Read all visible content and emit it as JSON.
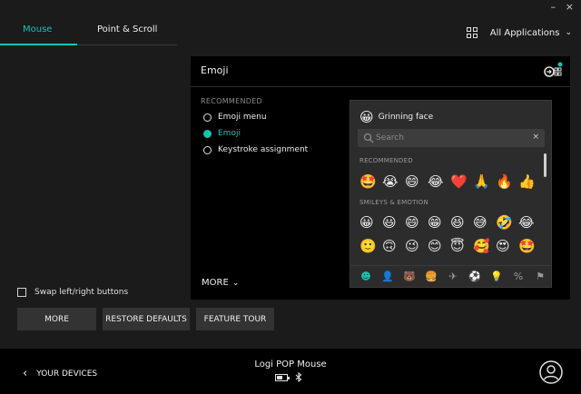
{
  "window": {
    "minimize": "–",
    "close": "×"
  },
  "tabs": [
    {
      "label": "Mouse",
      "active": true
    },
    {
      "label": "Point & Scroll",
      "active": false
    }
  ],
  "apps": {
    "label": "All Applications",
    "icon": "grid-icon",
    "chevron": "⌄"
  },
  "panel": {
    "title": "Emoji",
    "icon": "action-assign-icon",
    "recommended_label": "RECOMMENDED",
    "options": [
      {
        "label": "Emoji menu",
        "selected": false
      },
      {
        "label": "Emoji",
        "selected": true
      },
      {
        "label": "Keystroke assignment",
        "selected": false
      }
    ],
    "more_label": "MORE",
    "more_chevron": "⌄"
  },
  "picker": {
    "preview_emoji": "😀",
    "preview_name": "Grinning face",
    "search_placeholder": "Search",
    "search_clear": "×",
    "sections": [
      {
        "label": "RECOMMENDED",
        "rows": [
          [
            "🤩",
            "😭",
            "😄",
            "😂",
            "❤️",
            "🙏",
            "🔥",
            "👍"
          ]
        ]
      },
      {
        "label": "SMILEYS & EMOTION",
        "rows": [
          [
            "😀",
            "😃",
            "😄",
            "😁",
            "😆",
            "😅",
            "🤣",
            "😂"
          ],
          [
            "🙂",
            "🙃",
            "😉",
            "😊",
            "😇",
            "🥰",
            "😍",
            "🤩"
          ]
        ]
      }
    ],
    "categories": [
      "☻",
      "👤",
      "🐻",
      "🍔",
      "✈",
      "⚽",
      "💡",
      "%",
      "⚑"
    ],
    "accent": "#14c3b5"
  },
  "swap": {
    "label": "Swap left/right buttons",
    "checked": false
  },
  "buttons": {
    "more": "MORE",
    "restore": "RESTORE DEFAULTS",
    "tour": "FEATURE TOUR"
  },
  "footer": {
    "back_label": "YOUR DEVICES",
    "device_name": "Logi POP Mouse",
    "battery_level": 0.6,
    "connection_icon": "bluetooth-icon"
  }
}
